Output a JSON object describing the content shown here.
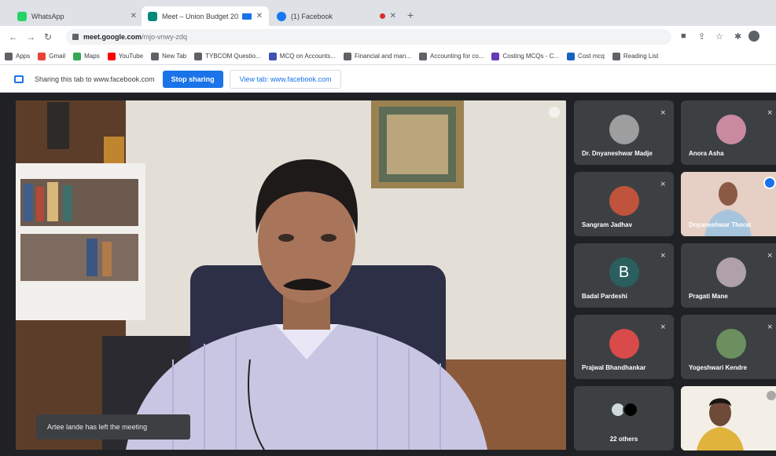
{
  "tabs": [
    {
      "title": "WhatsApp",
      "color": "#25d366"
    },
    {
      "title": "Meet – Union Budget 202…",
      "color": "#00897b"
    },
    {
      "title": "(1) Facebook",
      "color": "#1877f2"
    }
  ],
  "address": {
    "host": "meet.google.com",
    "path": "/mjo-vnwy-zdq"
  },
  "bookmarks": [
    {
      "label": "Apps",
      "color": "#5f6368"
    },
    {
      "label": "Gmail",
      "color": "#ea4335"
    },
    {
      "label": "Maps",
      "color": "#34a853"
    },
    {
      "label": "YouTube",
      "color": "#ff0000"
    },
    {
      "label": "New Tab",
      "color": "#5f6368"
    },
    {
      "label": "TYBCOM Questio...",
      "color": "#5f6368"
    },
    {
      "label": "MCQ on Accounts...",
      "color": "#3f51b5"
    },
    {
      "label": "Financial and man...",
      "color": "#5f6368"
    },
    {
      "label": "Accounting for co...",
      "color": "#5f6368"
    },
    {
      "label": "Costing MCQs - C...",
      "color": "#673ab7"
    },
    {
      "label": "Cost mcq",
      "color": "#1565c0"
    },
    {
      "label": "Reading List",
      "color": "#5f6368"
    }
  ],
  "share": {
    "text": "Sharing this tab to www.facebook.com",
    "stop_label": "Stop sharing",
    "view_label": "View tab: www.facebook.com"
  },
  "toast": "Artee lande has left the meeting",
  "participants": [
    {
      "name": "Dr. Dnyaneshwar Madje",
      "avatar_color": "#9e9e9e"
    },
    {
      "name": "Anora Asha",
      "avatar_color": "#c98aa0"
    },
    {
      "name": "Sangram Jadhav",
      "avatar_color": "#c0533c"
    },
    {
      "name": "Dnyaneshwar Thorat",
      "avatar_color": "#d9a58b"
    },
    {
      "name": "Badal Pardeshi",
      "avatar_letter": "B",
      "avatar_color": "#2b5f5f"
    },
    {
      "name": "Pragati Mane",
      "avatar_color": "#b0a0a8"
    },
    {
      "name": "Prajwal Bhandhankar",
      "avatar_color": "#d94a4a"
    },
    {
      "name": "Yogeshwari Kendre",
      "avatar_color": "#6b8f5e"
    },
    {
      "name": "22 others"
    }
  ]
}
